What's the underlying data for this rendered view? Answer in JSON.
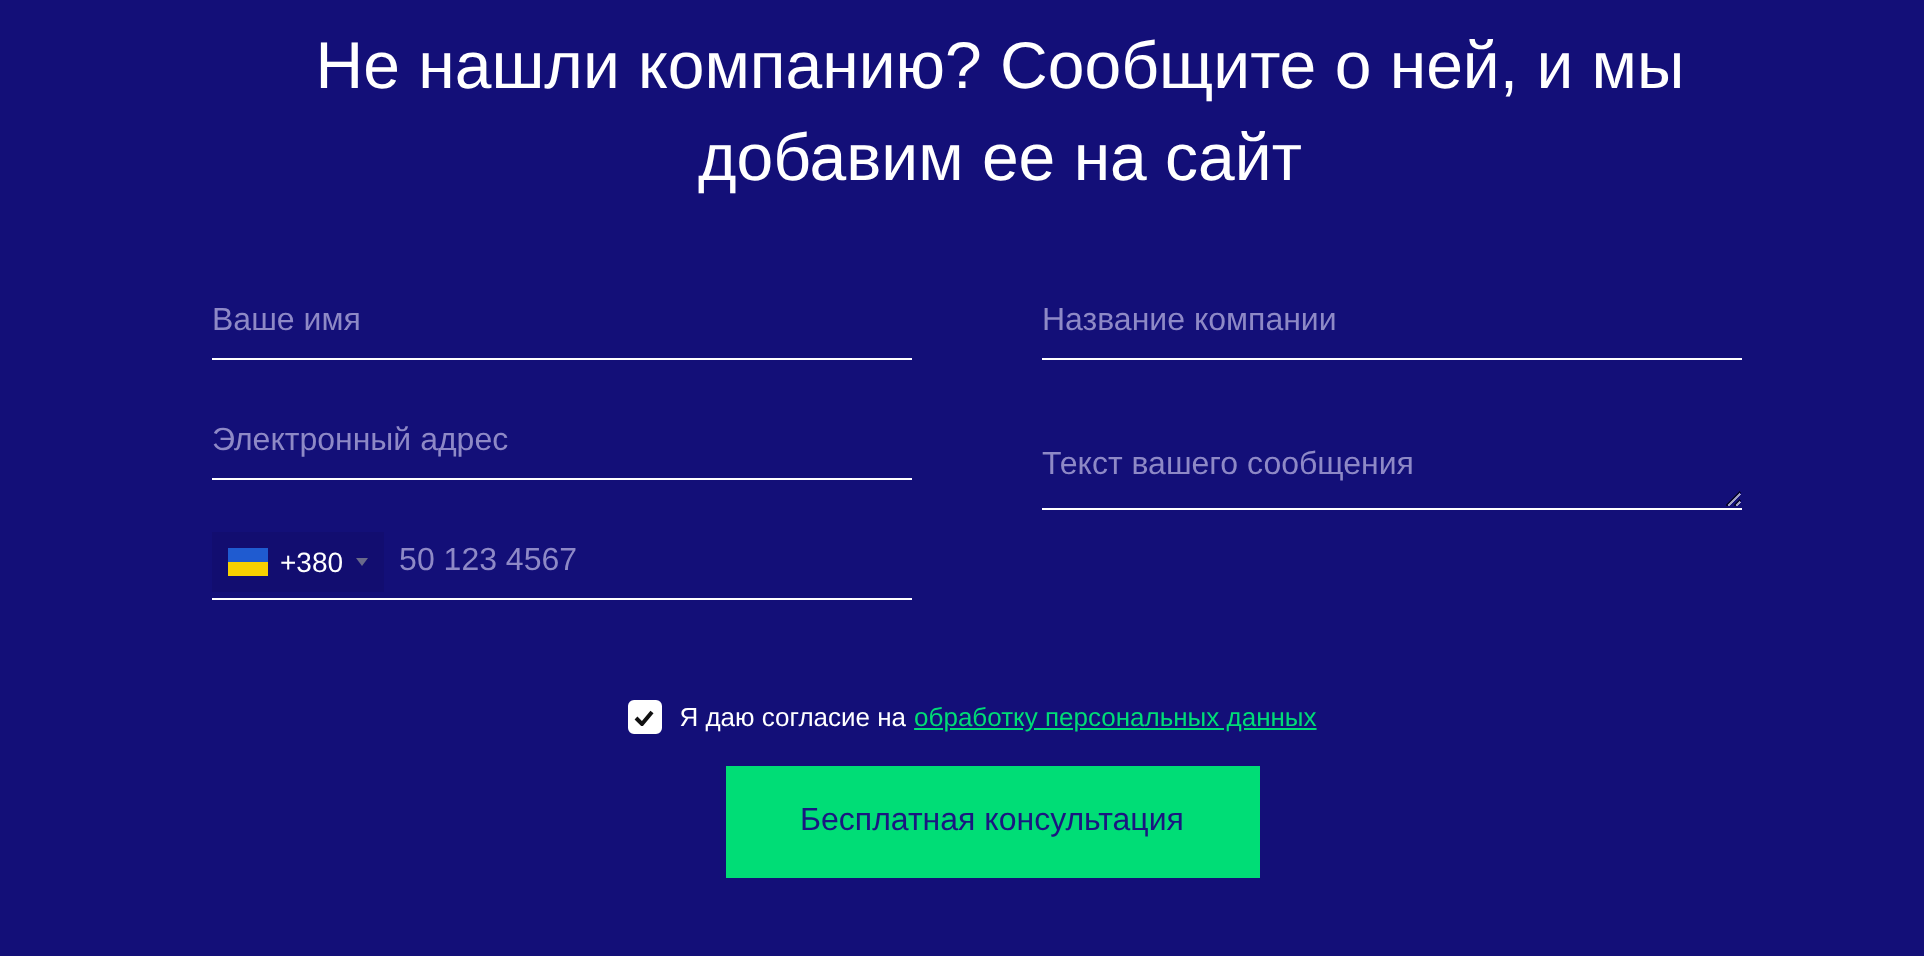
{
  "title": "Не нашли компанию? Сообщите о ней, и мы добавим ее на сайт",
  "left_fields": [
    {
      "kind": "text",
      "placeholder": "Ваше имя"
    },
    {
      "kind": "text",
      "placeholder": "Электронный адрес"
    },
    {
      "kind": "phone",
      "country_code": "+380",
      "placeholder": "50 123 4567"
    }
  ],
  "right_fields": [
    {
      "kind": "text",
      "placeholder": "Название компании"
    },
    {
      "kind": "textarea",
      "placeholder": "Текст вашего сообщения"
    }
  ],
  "consent": {
    "checked": true,
    "text": "Я даю согласие на",
    "link": "обработку персональных данных"
  },
  "submit_button": "Бесплатная консультация"
}
